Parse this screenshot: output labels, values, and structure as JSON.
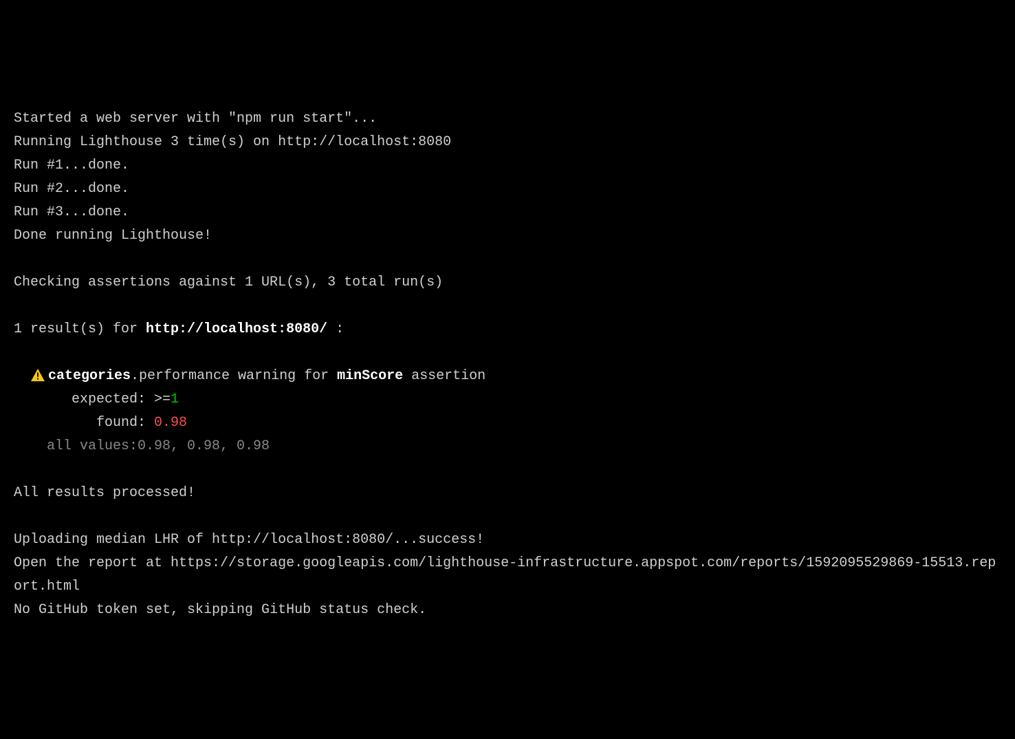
{
  "log": {
    "started": "Started a web server with \"npm run start\"...",
    "running": "Running Lighthouse 3 time(s) on http://localhost:8080",
    "run1": "Run #1...done.",
    "run2": "Run #2...done.",
    "run3": "Run #3...done.",
    "doneRunning": "Done running Lighthouse!",
    "checking": "Checking assertions against 1 URL(s), 3 total run(s)",
    "results_prefix": "1 result(s) for ",
    "results_url": "http://localhost:8080/",
    "results_suffix": " :"
  },
  "assertion": {
    "category_bold": "categories",
    "category_rest": ".performance warning for ",
    "metric": "minScore",
    "suffix": " assertion",
    "expected_label": "expected: ",
    "expected_op": ">=",
    "expected_value": "1",
    "found_label": "found: ",
    "found_value": "0.98",
    "allvalues_label": "all values: ",
    "allvalues_value": "0.98, 0.98, 0.98"
  },
  "footer": {
    "processed": "All results processed!",
    "uploading": "Uploading median LHR of http://localhost:8080/...success!",
    "open_report": "Open the report at https://storage.googleapis.com/lighthouse-infrastructure.appspot.com/reports/1592095529869-15513.report.html",
    "no_token": "No GitHub token set, skipping GitHub status check."
  }
}
